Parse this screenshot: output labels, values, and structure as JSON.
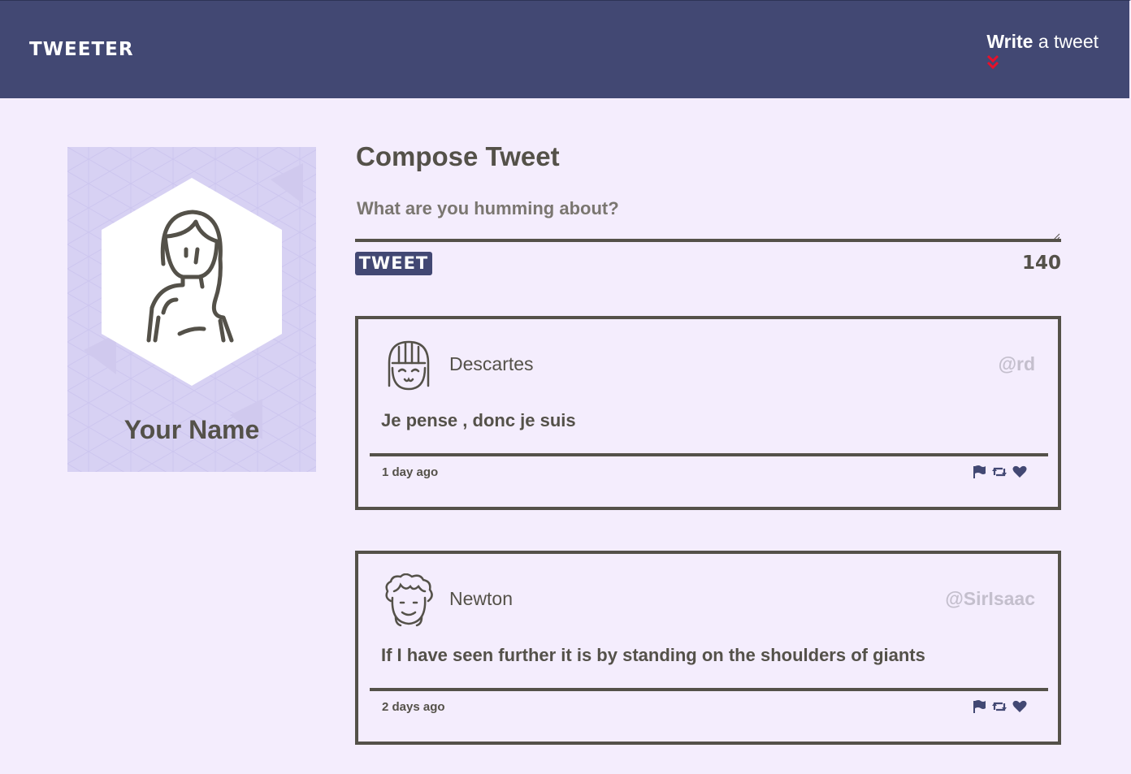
{
  "navbar": {
    "brand": "TWEETER",
    "write_bold": "Write",
    "write_rest": " a tweet",
    "chevron_icon": "double-chevron-down-icon",
    "chevron_color": "#e8102a"
  },
  "profile": {
    "name": "Your Name"
  },
  "compose": {
    "title": "Compose Tweet",
    "placeholder": "What are you humming about?",
    "button_label": "TWEET",
    "counter": "140"
  },
  "tweets": [
    {
      "name": "Descartes",
      "handle": "@rd",
      "content": "Je pense , donc je suis",
      "time": "1 day ago"
    },
    {
      "name": "Newton",
      "handle": "@SirIsaac",
      "content": "If I have seen further it is by standing on the shoulders of giants",
      "time": "2 days ago"
    }
  ],
  "icons": {
    "flag": "flag-icon",
    "retweet": "retweet-icon",
    "heart": "heart-icon"
  },
  "colors": {
    "navbar_bg": "#424873",
    "page_bg": "#f4edfd",
    "text": "#545149",
    "handle": "#c4bfcd",
    "profile_bg": "#d7d1f3",
    "accent": "#e8102a"
  }
}
